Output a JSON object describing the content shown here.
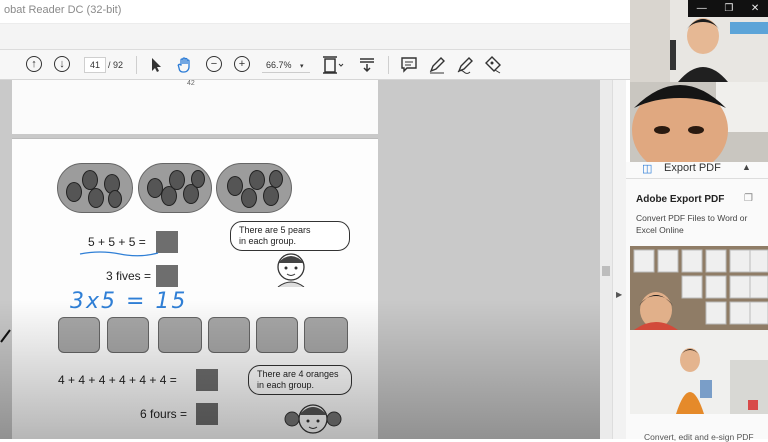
{
  "window": {
    "title": "obat Reader DC (32-bit)"
  },
  "toolbar": {
    "page_current": "41",
    "page_total": "/ 92",
    "zoom": "66.7%"
  },
  "document": {
    "prev_page_number": "42",
    "row1_equation": "5 + 5 + 5 =",
    "row1_words": "3 fives =",
    "row1_bubble_line1": "There are 5 pears",
    "row1_bubble_line2": "in each group.",
    "handwriting": "3x5 = 15",
    "row2_equation": "4 + 4 + 4 + 4 + 4 + 4 =",
    "row2_words": "6 fours =",
    "row2_bubble_line1": "There are 4 oranges",
    "row2_bubble_line2": "in each group."
  },
  "export_panel": {
    "tab_label": "Export PDF",
    "title": "Adobe Export PDF",
    "description": "Convert PDF Files to Word or Excel Online",
    "footer": "Convert, edit and e-sign PDF"
  },
  "icons": {
    "prev_page": "arrow-up-circle-icon",
    "next_page": "arrow-down-circle-icon",
    "select": "cursor-icon",
    "hand": "hand-icon",
    "zoom_out": "minus-circle-icon",
    "zoom_in": "plus-circle-icon",
    "fit": "fit-page-icon",
    "scroll": "scroll-mode-icon",
    "comment": "comment-icon",
    "highlight": "pen-icon",
    "sign": "sign-icon",
    "stamp": "stamp-icon"
  },
  "colors": {
    "handwriting": "#2f7fd6",
    "export_accent": "#2a7bd6"
  }
}
